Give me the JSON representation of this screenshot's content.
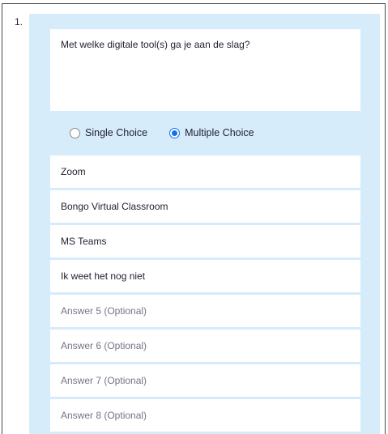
{
  "question": {
    "number": "1.",
    "text": "Met welke digitale tool(s) ga je aan de slag?"
  },
  "choice_type": {
    "options": [
      {
        "label": "Single Choice",
        "selected": false
      },
      {
        "label": "Multiple Choice",
        "selected": true
      }
    ]
  },
  "answers": [
    {
      "value": "Zoom",
      "is_placeholder": false
    },
    {
      "value": "Bongo Virtual Classroom",
      "is_placeholder": false
    },
    {
      "value": "MS Teams",
      "is_placeholder": false
    },
    {
      "value": "Ik weet het nog niet",
      "is_placeholder": false
    },
    {
      "value": "Answer 5 (Optional)",
      "is_placeholder": true
    },
    {
      "value": "Answer 6 (Optional)",
      "is_placeholder": true
    },
    {
      "value": "Answer 7 (Optional)",
      "is_placeholder": true
    },
    {
      "value": "Answer 8 (Optional)",
      "is_placeholder": true
    }
  ],
  "colors": {
    "card_background": "#d6ecfb",
    "accent": "#0e71eb",
    "placeholder_text": "#747487"
  }
}
